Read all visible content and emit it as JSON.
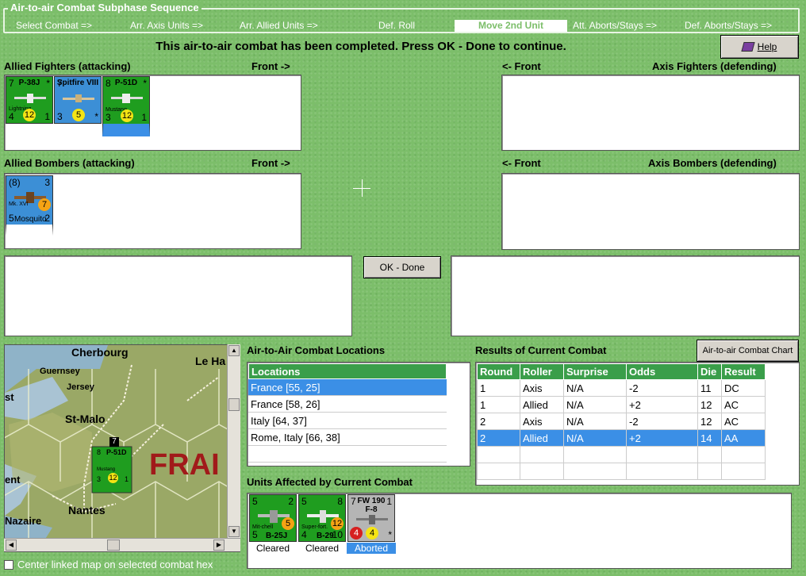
{
  "phase_bar": {
    "title": "Air-to-air Combat Subphase Sequence",
    "steps": [
      "Select Combat =>",
      "Arr. Axis Units =>",
      "Arr. Allied Units =>",
      "Def. Roll",
      "Move 2nd Unit",
      "Att. Aborts/Stays =>",
      "Def. Aborts/Stays =>"
    ],
    "current": "Move 2nd Unit"
  },
  "status_message": "This air-to-air combat has been completed.  Press OK - Done to continue.",
  "help_label": "Help",
  "allied_fighters": {
    "label": "Allied Fighters (attacking)",
    "front": "Front ->",
    "units": [
      {
        "name": "P-38J",
        "sub": "Lightning",
        "tl": "7",
        "tr": "*",
        "bl": "4",
        "br": "1",
        "val": "12",
        "color": "#1f9d1f"
      },
      {
        "name": "Spitfire VIII",
        "sub": "",
        "tl": "7",
        "tr": "",
        "bl": "3",
        "br": "*",
        "val": "5",
        "color": "#3c8fd6"
      },
      {
        "name": "P-51D",
        "sub": "Mustang",
        "tl": "8",
        "tr": "*",
        "bl": "3",
        "br": "1",
        "val": "12",
        "color": "#1f9d1f"
      }
    ]
  },
  "axis_fighters": {
    "label": "Axis Fighters (defending)",
    "front": "<- Front"
  },
  "allied_bombers": {
    "label": "Allied Bombers (attacking)",
    "front": "Front ->",
    "units": [
      {
        "name": "Mosquito",
        "sub": "Mk. XVI",
        "tl": "(8)",
        "tr": "3",
        "bl": "5",
        "br": "2",
        "val": "7",
        "color": "#3c8fd6"
      }
    ]
  },
  "axis_bombers": {
    "label": "Axis Bombers (defending)",
    "front": "<- Front"
  },
  "ok_done_label": "OK - Done",
  "map": {
    "places": [
      "Cherbourg",
      "Guernsey",
      "Jersey",
      "St-Malo",
      "Le Ha",
      "FRAI",
      "ent",
      "Nantes",
      "Nazaire",
      "st"
    ],
    "unit": {
      "name": "P-51D",
      "sub": "Mustang",
      "tl": "8",
      "bl": "3",
      "br": "1",
      "val": "12",
      "stack": "7"
    }
  },
  "center_map_label": "Center linked map on selected combat hex",
  "locations": {
    "title": "Air-to-Air Combat Locations",
    "header": "Locations",
    "items": [
      "France [55, 25]",
      "France [58, 26]",
      "Italy [64, 37]",
      "Rome, Italy [66, 38]"
    ],
    "selected_index": 0
  },
  "results": {
    "title": "Results of Current Combat",
    "chart_button": "Air-to-air Combat Chart",
    "headers": [
      "Round",
      "Roller",
      "Surprise",
      "Odds",
      "Die",
      "Result"
    ],
    "rows": [
      [
        "1",
        "Axis",
        "N/A",
        "-2",
        "11",
        "DC"
      ],
      [
        "1",
        "Allied",
        "N/A",
        "+2",
        "12",
        "AC"
      ],
      [
        "2",
        "Axis",
        "N/A",
        "-2",
        "12",
        "AC"
      ],
      [
        "2",
        "Allied",
        "N/A",
        "+2",
        "14",
        "AA"
      ]
    ],
    "selected_index": 3
  },
  "affected": {
    "title": "Units Affected by Current Combat",
    "units": [
      {
        "name": "B-25J",
        "sub": "Mit-chell",
        "tl": "5",
        "tr": "2",
        "bl": "5",
        "br": "",
        "val": "5",
        "status": "Cleared",
        "color": "#1f9d1f"
      },
      {
        "name": "B-29",
        "sub": "Super-fort.",
        "tl": "5",
        "tr": "8",
        "bl": "4",
        "br": "10",
        "val": "12",
        "status": "Cleared",
        "color": "#1f9d1f"
      },
      {
        "name": "FW 190 F-8",
        "sub": "",
        "tl": "7",
        "tr": "1",
        "bl": "4",
        "br": "*",
        "val": "4",
        "status": "Aborted",
        "color": "#b5b5b5"
      }
    ],
    "selected_index": 2
  },
  "colors": {
    "accent": "#3a9e4a",
    "selection": "#3b8fe6",
    "background": "#7cbe6a"
  }
}
